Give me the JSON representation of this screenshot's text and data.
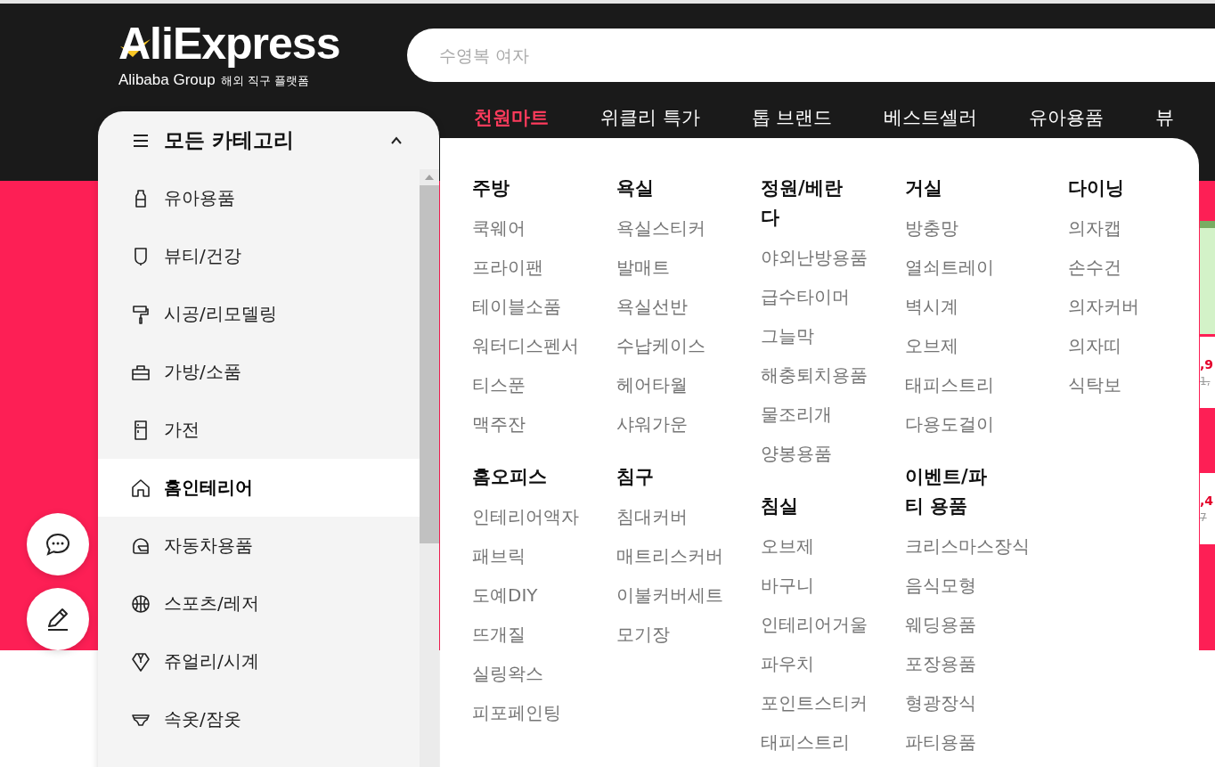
{
  "header": {
    "logo": {
      "wordmark": "AliExpress",
      "group": "Alibaba Group",
      "tagline": "해외 직구 플랫폼"
    },
    "search": {
      "placeholder": "수영복 여자"
    }
  },
  "nav": [
    {
      "label": "천원마트",
      "selected": true
    },
    {
      "label": "위클리 특가",
      "selected": false
    },
    {
      "label": "톱 브랜드",
      "selected": false
    },
    {
      "label": "베스트셀러",
      "selected": false
    },
    {
      "label": "유아용품",
      "selected": false
    },
    {
      "label": "뷰",
      "selected": false
    }
  ],
  "categories": {
    "title": "모든 카테고리",
    "expanded": true,
    "items": [
      {
        "label": "유아용품",
        "selected": false
      },
      {
        "label": "뷰티/건강",
        "selected": false
      },
      {
        "label": "시공/리모델링",
        "selected": false
      },
      {
        "label": "가방/소품",
        "selected": false
      },
      {
        "label": "가전",
        "selected": false
      },
      {
        "label": "홈인테리어",
        "selected": true
      },
      {
        "label": "자동차용품",
        "selected": false
      },
      {
        "label": "스포츠/레저",
        "selected": false
      },
      {
        "label": "쥬얼리/시계",
        "selected": false
      },
      {
        "label": "속옷/잠옷",
        "selected": false
      }
    ]
  },
  "submenu": {
    "columns": [
      [
        {
          "heading": "주방",
          "items": [
            "쿡웨어",
            "프라이팬",
            "테이블소품",
            "워터디스펜서",
            "티스푼",
            "맥주잔"
          ]
        },
        {
          "heading": "홈오피스",
          "items": [
            "인테리어액자",
            "패브릭",
            "도예DIY",
            "뜨개질",
            "실링왁스",
            "피포페인팅"
          ]
        }
      ],
      [
        {
          "heading": "욕실",
          "items": [
            "욕실스티커",
            "발매트",
            "욕실선반",
            "수납케이스",
            "헤어타월",
            "샤워가운"
          ]
        },
        {
          "heading": "침구",
          "items": [
            "침대커버",
            "매트리스커버",
            "이불커버세트",
            "모기장"
          ]
        }
      ],
      [
        {
          "heading": "정원/베란다",
          "items": [
            "야외난방용품",
            "급수타이머",
            "그늘막",
            "해충퇴치용품",
            "물조리개",
            "양봉용품"
          ]
        },
        {
          "heading": "침실",
          "items": [
            "오브제",
            "바구니",
            "인테리어거울",
            "파우치",
            "포인트스티커",
            "태피스트리"
          ]
        }
      ],
      [
        {
          "heading": "거실",
          "items": [
            "방충망",
            "열쇠트레이",
            "벽시계",
            "오브제",
            "태피스트리",
            "다용도걸이"
          ]
        },
        {
          "heading": "이벤트/파티 용품",
          "items": [
            "크리스마스장식",
            "음식모형",
            "웨딩용품",
            "포장용품",
            "형광장식",
            "파티용품"
          ]
        }
      ],
      [
        {
          "heading": "다이닝",
          "items": [
            "의자캡",
            "손수건",
            "의자커버",
            "의자띠",
            "식탁보"
          ]
        }
      ]
    ]
  },
  "products": [
    {
      "price": ",9",
      "old_price": "1,"
    },
    {
      "price": ",4",
      "old_price": "7"
    }
  ]
}
